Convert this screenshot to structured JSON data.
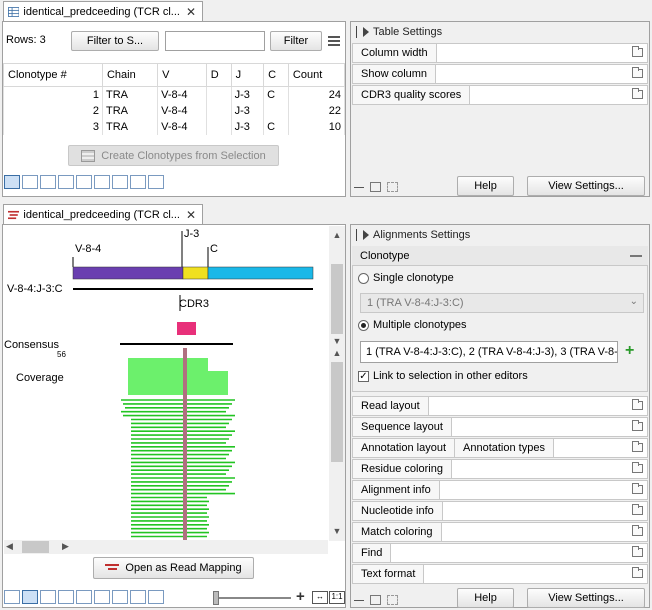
{
  "top_tab": {
    "title": "identical_predceeding (TCR cl...",
    "close": "✕"
  },
  "toolbar": {
    "rows_label": "Rows: 3",
    "filter_to_selection": "Filter to S...",
    "filter_input_value": "",
    "filter_button": "Filter",
    "menu_icon": "menu-icon"
  },
  "table": {
    "columns": [
      "Clonotype #",
      "Chain",
      "V",
      "D",
      "J",
      "C",
      "Count"
    ],
    "rows": [
      [
        "1",
        "TRA",
        "V-8-4",
        "",
        "J-3",
        "C",
        "24"
      ],
      [
        "2",
        "TRA",
        "V-8-4",
        "",
        "J-3",
        "",
        "22"
      ],
      [
        "3",
        "TRA",
        "V-8-4",
        "",
        "J-3",
        "C",
        "10"
      ]
    ]
  },
  "create_clonotypes_button": "Create Clonotypes from Selection",
  "table_settings": {
    "title": "Table Settings",
    "sections": [
      "Column width",
      "Show column",
      "CDR3 quality scores"
    ],
    "help": "Help",
    "view_settings": "View Settings..."
  },
  "bottom_tab": {
    "title": "identical_predceeding (TCR cl...",
    "close": "✕"
  },
  "alignment_view": {
    "labels": {
      "v_gene": "V-8-4",
      "j_gene": "J-3",
      "c_gene": "C",
      "ref_name": "V-8-4:J-3:C",
      "cdr3": "CDR3",
      "consensus": "Consensus",
      "consensus_pos": "56",
      "coverage": "Coverage"
    },
    "colors": {
      "v_segment": "#6a3fb0",
      "j_segment": "#f0e020",
      "c_segment": "#1ab8e8",
      "cdr3": "#e8307a",
      "reads": "#22c422",
      "coverage": "#6cf06c",
      "mismatch": "#a06070"
    },
    "open_as_read_mapping": "Open as Read Mapping",
    "zoom_one_to_one": "1:1"
  },
  "alignment_settings": {
    "title": "Alignments Settings",
    "clonotype_section": "Clonotype",
    "single_clonotype": "Single clonotype",
    "single_selected": "1 (TRA V-8-4:J-3:C)",
    "multiple_clonotypes": "Multiple clonotypes",
    "multiple_value": "1 (TRA V-8-4:J-3:C), 2 (TRA V-8-4:J-3), 3 (TRA V-8-",
    "add_icon": "plus-icon",
    "link_to_selection": "Link to selection in other editors",
    "sections": [
      "Read layout",
      "Sequence layout",
      "Annotation layout",
      "Residue coloring",
      "Alignment info",
      "Nucleotide info",
      "Match coloring",
      "Find",
      "Text format"
    ],
    "annotation_types": "Annotation types",
    "help": "Help",
    "view_settings": "View Settings..."
  }
}
